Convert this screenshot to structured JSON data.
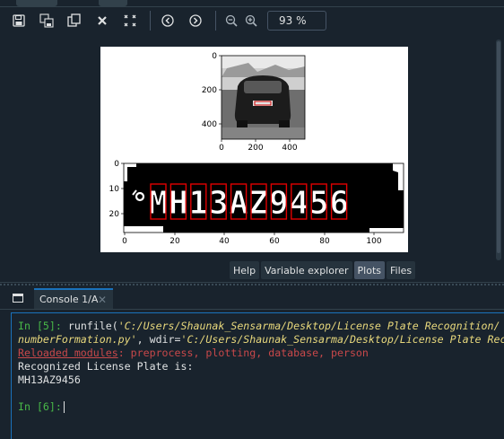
{
  "toolbar": {
    "zoom_value": "93 %",
    "buttons": [
      "save-icon",
      "save-all-icon",
      "copy-icon",
      "close-icon",
      "close-all-icon",
      "previous-icon",
      "next-icon",
      "zoom-out-icon",
      "zoom-in-icon"
    ]
  },
  "figure": {
    "car_plot": {
      "yticks": [
        "0",
        "200",
        "400"
      ],
      "xticks": [
        "0",
        "200",
        "400"
      ]
    },
    "plate_plot": {
      "yticks": [
        "0",
        "10",
        "20"
      ],
      "xticks": [
        "0",
        "20",
        "40",
        "60",
        "80",
        "100"
      ],
      "characters": [
        "M",
        "H",
        "1",
        "3",
        "A",
        "Z",
        "9",
        "4",
        "5",
        "6"
      ]
    }
  },
  "pane_tabs": [
    "Help",
    "Variable explorer",
    "Plots",
    "Files"
  ],
  "active_pane_tab": "Plots",
  "console": {
    "tab_label": "Console 1/A",
    "in5_prompt": "In [5]:",
    "in5_code_fn": " runfile(",
    "in5_code_path": "'C:/Users/Shaunak_Sensarma/Desktop/License Plate Recognition/",
    "in5_line2_file": "numberFormation.py'",
    "in5_line2_mid": ", wdir=",
    "in5_line2_wdir": "'C:/Users/Shaunak_Sensarma/Desktop/License Plate Rec",
    "reloaded_label": "Reloaded modules",
    "reloaded_modules": ": preprocess, plotting, database, person",
    "output_line1": "Recognized License Plate is:",
    "output_line2": "MH13AZ9456",
    "in6_prompt": "In [6]:"
  }
}
